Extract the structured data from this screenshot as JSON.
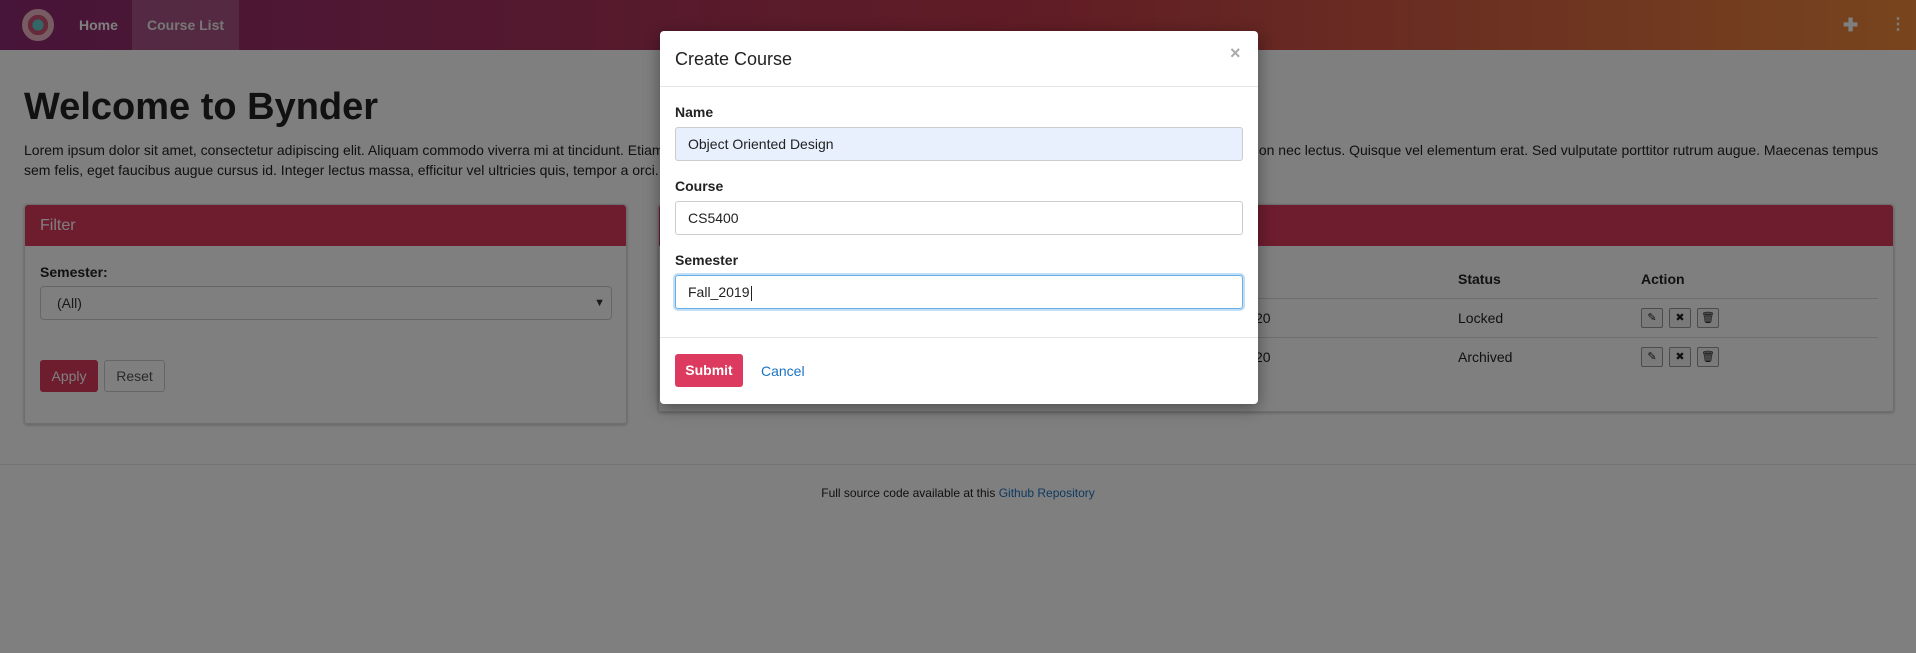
{
  "navbar": {
    "home": "Home",
    "course_list": "Course List",
    "add_icon": "plus-icon",
    "more_icon": "vertical-ellipsis-icon",
    "more_glyph": "⋮",
    "add_glyph": "✚"
  },
  "page": {
    "title": "Welcome to Bynder",
    "lorem": "Lorem ipsum dolor sit amet, consectetur adipiscing elit. Aliquam commodo viverra mi at tincidunt. Etiam ornare mi mauris, sit amet ultrices erat placerat vitae. Morbi sed mauris ut erat pretium blandit non nec lectus. Quisque vel elementum erat. Sed vulputate porttitor rutrum augue. Maecenas tempus sem felis, eget faucibus augue cursus id. Integer lectus massa, efficitur vel ultricies quis, tempor a orci. In quam neque, fringilla sed lorem nec, auctor lacinia enim. Donec blandit ornare lacus."
  },
  "filter": {
    "title": "Filter",
    "semester_label": "Semester:",
    "semester_value": "(All)",
    "apply": "Apply",
    "reset": "Reset"
  },
  "courses": {
    "columns": {
      "status": "Status",
      "action": "Action"
    },
    "rows": [
      {
        "semester_tail": "20",
        "status": "Locked"
      },
      {
        "semester_tail": "20",
        "status": "Archived"
      }
    ],
    "action_icons": [
      "edit-icon",
      "close-icon",
      "trash-icon"
    ]
  },
  "footer": {
    "text": "Full source code available at this",
    "link": "Github Repository"
  },
  "modal": {
    "title": "Create Course",
    "close": "×",
    "name_label": "Name",
    "name_value": "Object Oriented Design",
    "course_label": "Course",
    "course_value": "CS5400",
    "semester_label": "Semester",
    "semester_value": "Fall_2019",
    "submit": "Submit",
    "cancel": "Cancel"
  },
  "colors": {
    "accent": "#dc3a5e",
    "link": "#1a73c2",
    "nav_gradient_start": "#8e2a72",
    "nav_gradient_end": "#f08a3c"
  }
}
